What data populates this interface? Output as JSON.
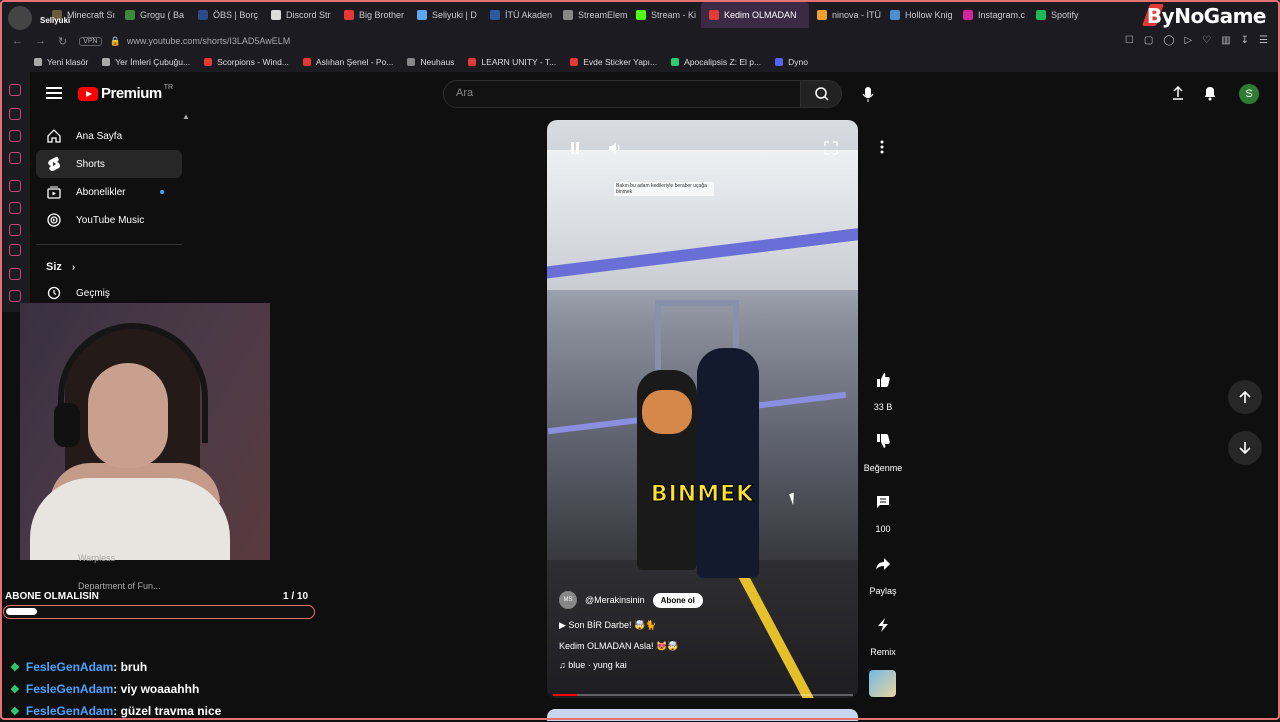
{
  "browser": {
    "profile_label": "Seliyuki",
    "tabs": [
      {
        "label": "Minecraft Sı",
        "color": "#6b5a3a"
      },
      {
        "label": "Grogu ( Ba",
        "color": "#3a8a3a"
      },
      {
        "label": "ÖBS | Borç",
        "color": "#2a4a8a"
      },
      {
        "label": "Discord Str",
        "color": "#ddd"
      },
      {
        "label": "Big Brother",
        "color": "#e53935"
      },
      {
        "label": "Seliyuki | D",
        "color": "#5ea8f0"
      },
      {
        "label": "İTÜ Akaden",
        "color": "#2a5aa0"
      },
      {
        "label": "StreamElem",
        "color": "#888"
      },
      {
        "label": "Stream - Ki",
        "color": "#53fc18"
      },
      {
        "label": "Kedim OLMADAN",
        "color": "#e53935",
        "active": true
      },
      {
        "label": "ninova - İTÜ",
        "color": "#f0a030"
      },
      {
        "label": "Hollow Knig",
        "color": "#4a90d0"
      },
      {
        "label": "Instagram.c",
        "color": "#d6249f"
      },
      {
        "label": "Spotify",
        "color": "#1db954"
      }
    ],
    "brand": "ByNoGame",
    "vpn": "VPN",
    "url": "www.youtube.com/shorts/I3LAD5AwELM",
    "bookmarks": [
      {
        "label": "Yeni klasör",
        "color": "#aaa"
      },
      {
        "label": "Yer İmleri Çubuğu...",
        "color": "#aaa"
      },
      {
        "label": "Scorpions - Wind...",
        "color": "#e53935"
      },
      {
        "label": "Aslıhan Şenel - Po...",
        "color": "#e53935"
      },
      {
        "label": "Neuhaus",
        "color": "#888"
      },
      {
        "label": "LEARN UNITY - T...",
        "color": "#e53935"
      },
      {
        "label": "Evde Sticker Yapı...",
        "color": "#e53935"
      },
      {
        "label": "Apocalipsis Z: El p...",
        "color": "#2ecc71"
      },
      {
        "label": "Dyno",
        "color": "#5865f2"
      }
    ]
  },
  "youtube": {
    "logo_text": "Premium",
    "logo_region": "TR",
    "search_placeholder": "Ara",
    "profile_initial": "S",
    "sidebar": {
      "items": [
        {
          "label": "Ana Sayfa",
          "icon": "home-icon"
        },
        {
          "label": "Shorts",
          "icon": "shorts-icon",
          "active": true
        },
        {
          "label": "Abonelikler",
          "icon": "subscriptions-icon"
        },
        {
          "label": "YouTube Music",
          "icon": "music-icon"
        }
      ],
      "section": "Siz",
      "history": "Geçmiş",
      "hidden_items": [
        "Warpless",
        "Department of Fun..."
      ]
    },
    "short": {
      "overlay_text": "BINMEK",
      "top_caption": "Bakın bu adam kedileriyle beraber uçağa binmek",
      "channel": "@Merakinsinin",
      "channel_avatar": "MS",
      "subscribe": "Abone ol",
      "playlist": "Son BİR Darbe! 🤯🐈",
      "title": "Kedim OLMADAN Asla! 😻🤯",
      "music": "blue · yung kai",
      "progress": 0.08
    },
    "actions": {
      "likes": "33 B",
      "dislike": "Beğenme",
      "comments": "100",
      "share": "Paylaş",
      "remix": "Remix"
    }
  },
  "overlay": {
    "goal_label": "ABONE OLMALISIN",
    "goal_count": "1 / 10",
    "goal_progress": 0.1,
    "chat": [
      {
        "user": "FesleGenAdam",
        "msg": " : bruh"
      },
      {
        "user": "FesleGenAdam",
        "msg": " : viy woaaahhh"
      },
      {
        "user": "FesleGenAdam",
        "msg": " : güzel travma nice"
      }
    ]
  }
}
